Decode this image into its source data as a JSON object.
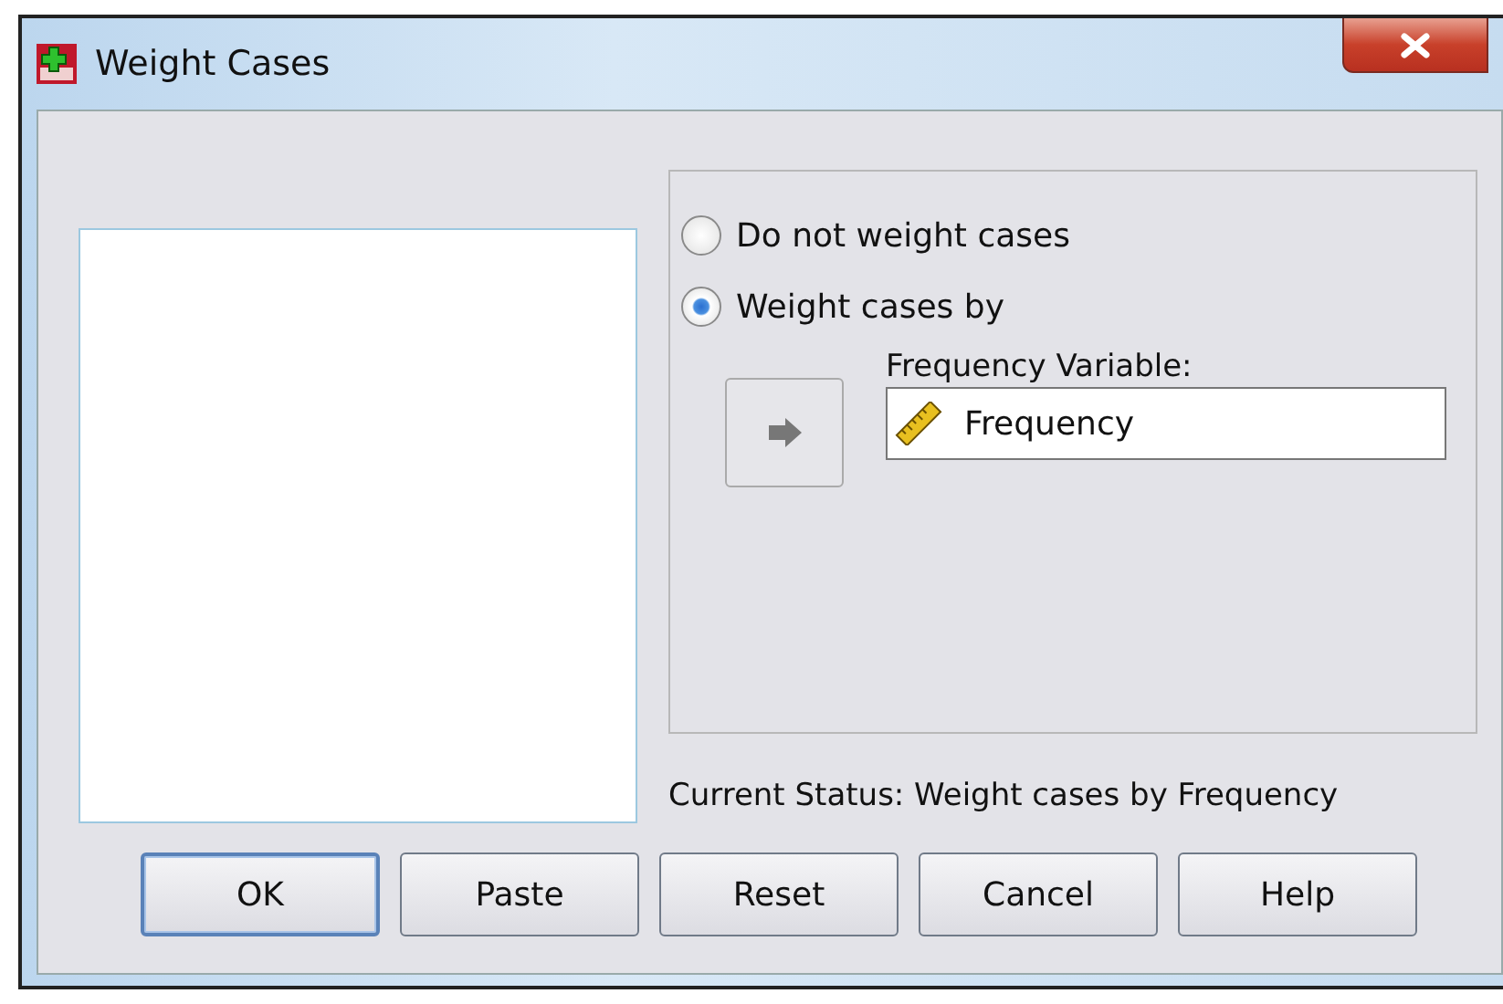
{
  "window": {
    "title": "Weight Cases"
  },
  "options": [
    {
      "label": "Do not weight cases",
      "selected": false
    },
    {
      "label": "Weight cases by",
      "selected": true
    }
  ],
  "frequency_variable": {
    "label": "Frequency Variable:",
    "value": "Frequency"
  },
  "status": "Current Status: Weight cases by Frequency",
  "buttons": [
    {
      "label": "OK",
      "default": true
    },
    {
      "label": "Paste",
      "default": false
    },
    {
      "label": "Reset",
      "default": false
    },
    {
      "label": "Cancel",
      "default": false
    },
    {
      "label": "Help",
      "default": false
    }
  ]
}
